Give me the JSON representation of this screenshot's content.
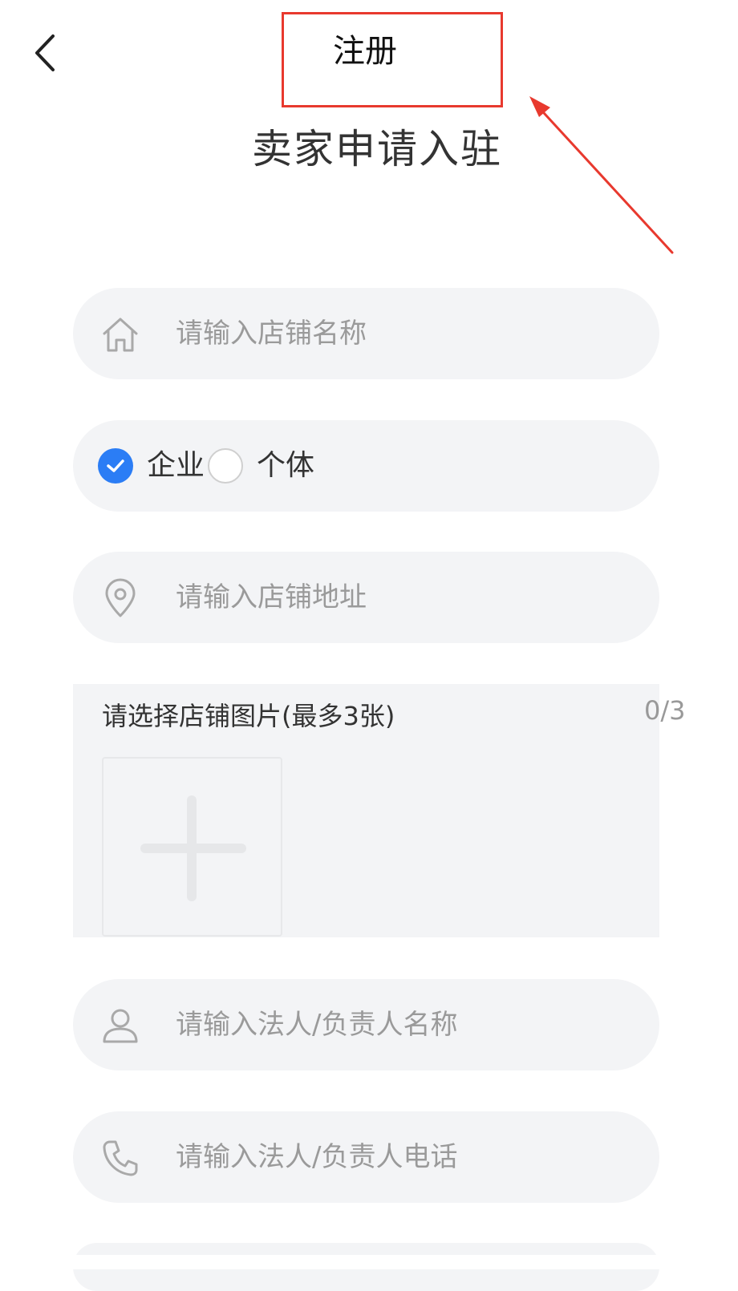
{
  "nav": {
    "back_icon": "chevron-left-icon",
    "title": "注册"
  },
  "page_title": "卖家申请入驻",
  "form": {
    "store_name": {
      "icon": "home-icon",
      "placeholder": "请输入店铺名称",
      "value": ""
    },
    "entity_type": {
      "options": [
        {
          "label": "企业",
          "selected": true
        },
        {
          "label": "个体",
          "selected": false
        }
      ]
    },
    "store_address": {
      "icon": "location-pin-icon",
      "placeholder": "请输入店铺地址",
      "value": ""
    },
    "store_images": {
      "label": "请选择店铺图片(最多3张)",
      "count": "0/3",
      "add_icon": "plus-icon"
    },
    "legal_person_name": {
      "icon": "user-icon",
      "placeholder": "请输入法人/负责人名称",
      "value": ""
    },
    "legal_person_phone": {
      "icon": "phone-icon",
      "placeholder": "请输入法人/负责人电话",
      "value": ""
    }
  },
  "colors": {
    "accent": "#2b7df5",
    "field_bg": "#f3f4f6",
    "annotation_red": "#e8392e",
    "placeholder": "#9a9a9a"
  }
}
